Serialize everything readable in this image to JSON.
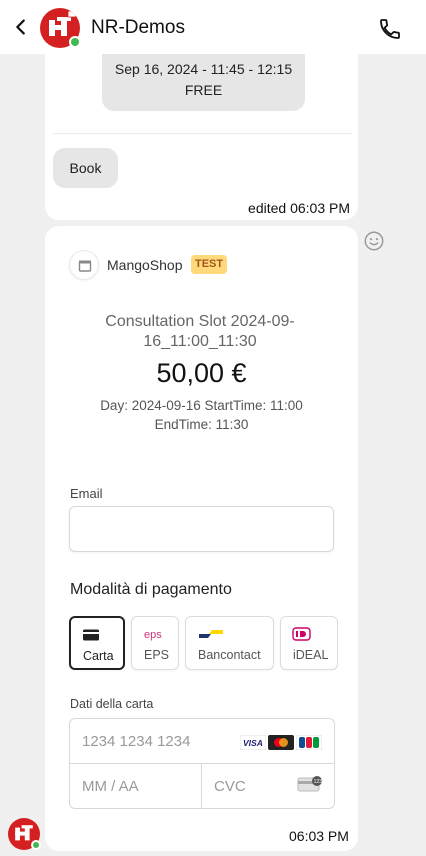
{
  "header": {
    "title": "NR-Demos",
    "back_icon": "back-arrow-icon",
    "call_icon": "phone-icon"
  },
  "message1": {
    "slot_line1": "Sep 16, 2024 - 11:45 - 12:15",
    "slot_line2": "FREE",
    "book_label": "Book",
    "time": "edited 06:03 PM"
  },
  "payment": {
    "shop_name": "MangoShop",
    "test_badge": "TEST",
    "product_name": "Consultation Slot 2024-09-16_11:00_11:30",
    "price": "50,00 €",
    "description": "Day: 2024-09-16 StartTime: 11:00 EndTime: 11:30",
    "email_label": "Email",
    "email_value": "",
    "methods_heading": "Modalità di pagamento",
    "methods": [
      {
        "label": "Carta",
        "selected": true
      },
      {
        "label": "EPS",
        "selected": false
      },
      {
        "label": "Bancontact",
        "selected": false
      },
      {
        "label": "iDEAL",
        "selected": false
      }
    ],
    "card_label": "Dati della carta",
    "card_number_placeholder": "1234 1234 1234",
    "expiry_placeholder": "MM / AA",
    "cvc_placeholder": "CVC",
    "card_brands": [
      "visa",
      "mastercard",
      "jcb"
    ],
    "time": "06:03 PM"
  },
  "colors": {
    "brand_red": "#d42020",
    "online": "#3fb950",
    "test_badge_bg": "#ffd97a",
    "test_badge_text": "#a3561b"
  }
}
